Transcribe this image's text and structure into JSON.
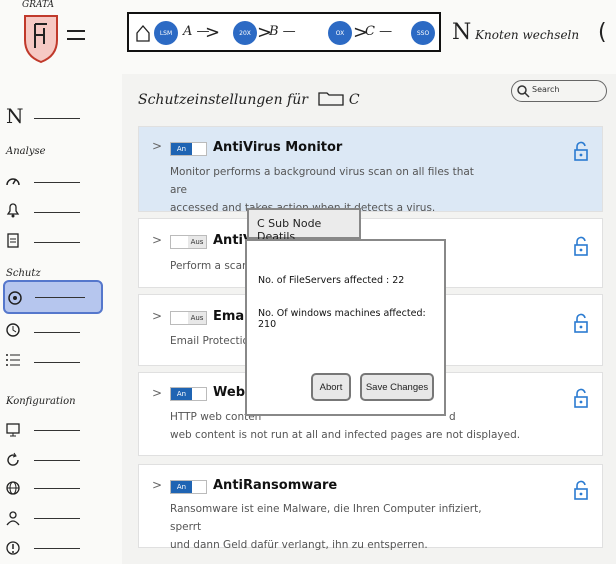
{
  "header": {
    "logo_text": "GRATA",
    "breadcrumb": {
      "nodes": [
        "LSM",
        "20X",
        "OX",
        "SSO"
      ],
      "segments": [
        "A —",
        "B —",
        "C —"
      ]
    },
    "switch_node": "Knoten wechseln"
  },
  "sidebar": {
    "top_letter": "N",
    "sections": [
      "Analyse",
      "Schutz",
      "Konfiguration"
    ],
    "items": [
      {
        "icon": "dashboard-icon"
      },
      {
        "icon": "bell-icon"
      },
      {
        "icon": "clipboard-icon"
      },
      {
        "icon": "shield-icon",
        "selected": true
      },
      {
        "icon": "clock-icon"
      },
      {
        "icon": "list-icon"
      },
      {
        "icon": "monitor-icon"
      },
      {
        "icon": "refresh-icon"
      },
      {
        "icon": "globe-icon"
      },
      {
        "icon": "user-icon"
      },
      {
        "icon": "alert-icon"
      }
    ]
  },
  "main": {
    "title": "Schutzeinstellungen für",
    "title_folder": "C",
    "search_placeholder": "Search",
    "cards": [
      {
        "toggle": "An",
        "state": "on",
        "title": "AntiVirus Monitor",
        "desc1": "Monitor performs a background virus scan on all files that are",
        "desc2": "accessed and takes action when it detects a virus."
      },
      {
        "toggle": "Aus",
        "state": "off",
        "title": "AntiV",
        "desc1": "Perform a scan w",
        "desc2": ""
      },
      {
        "toggle": "Aus",
        "state": "off",
        "title": "Emai",
        "desc1": "Email Protection",
        "desc2": ""
      },
      {
        "toggle": "An",
        "state": "on",
        "title": "Web p",
        "desc1": "HTTP web conten",
        "desc1_tail": "d",
        "desc2": "web content is not run at all and infected pages are not displayed."
      },
      {
        "toggle": "An",
        "state": "on",
        "title": "AntiRansomware",
        "desc1": "Ransomware ist eine Malware, die Ihren Computer infiziert, sperrt",
        "desc2": "und dann Geld dafür verlangt, ihn zu entsperren."
      }
    ]
  },
  "modal": {
    "tab": "C Sub Node Deatils",
    "line1": "No. of FileServers affected : 22",
    "line2": "No. Of windows machines affected: 210",
    "abort": "Abort",
    "save": "Save Changes"
  },
  "colors": {
    "accent": "#1f64b3",
    "selected": "#b6c6ee",
    "highlight": "#dce8f5"
  }
}
